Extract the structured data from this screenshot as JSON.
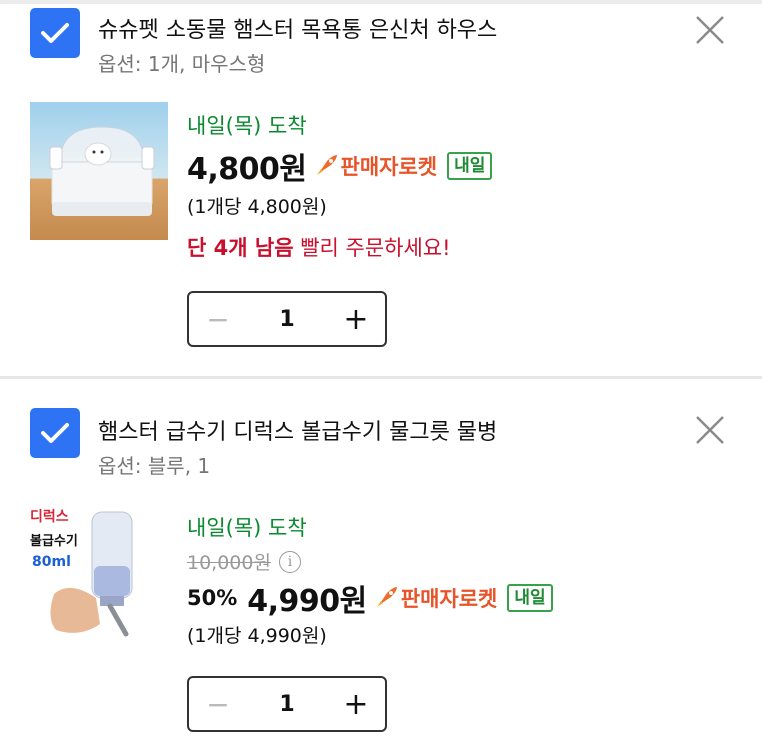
{
  "items": [
    {
      "title": "슈슈펫 소동물 햄스터 목욕통 은신처 하우스",
      "option": "옵션: 1개, 마우스형",
      "arrival": "내일(목) 도착",
      "price": "4,800원",
      "rocket_label": "판매자로켓",
      "badge": "내일",
      "unit_price": "(1개당 4,800원)",
      "stock_bold": "단 4개 남음",
      "stock_rest": " 빨리 주문하세요!",
      "quantity": "1",
      "checked": true
    },
    {
      "title": "햄스터 급수기 디럭스 볼급수기 물그릇 물병",
      "option": "옵션: 블루, 1",
      "arrival": "내일(목) 도착",
      "original_price": "10,000원",
      "discount": "50%",
      "price": "4,990원",
      "rocket_label": "판매자로켓",
      "badge": "내일",
      "unit_price": "(1개당 4,990원)",
      "quantity": "1",
      "thumb_text": [
        "디럭스",
        "볼급수기",
        "80ml"
      ],
      "checked": true
    }
  ],
  "controls": {
    "minus": "−",
    "plus": "+",
    "info": "i"
  },
  "colors": {
    "checkbox": "#2f73f5",
    "arrival": "#0a8a2e",
    "rocket": "#e8542a",
    "stock": "#c8102e"
  }
}
